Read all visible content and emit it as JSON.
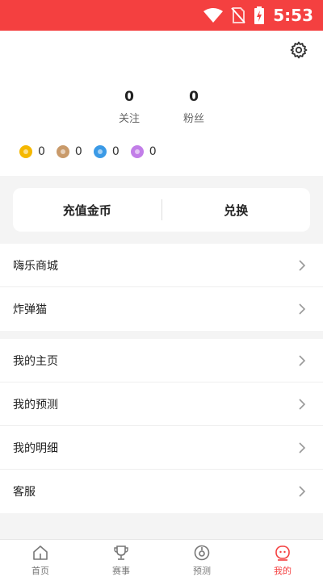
{
  "status_bar": {
    "time": "5:53"
  },
  "profile": {
    "following": {
      "value": "0",
      "label": "关注"
    },
    "fans": {
      "value": "0",
      "label": "粉丝"
    },
    "coins": [
      {
        "icon": "gold-coin-icon",
        "color": "#f5b800",
        "value": "0"
      },
      {
        "icon": "bronze-coin-icon",
        "color": "#c99a6a",
        "value": "0"
      },
      {
        "icon": "blue-gem-icon",
        "color": "#3b9ae6",
        "value": "0"
      },
      {
        "icon": "purple-gem-icon",
        "color": "#c27ee8",
        "value": "0"
      }
    ]
  },
  "actions": {
    "recharge": "充值金币",
    "exchange": "兑换"
  },
  "menu_group_1": [
    {
      "label": "嗨乐商城"
    },
    {
      "label": "炸弹猫"
    }
  ],
  "menu_group_2": [
    {
      "label": "我的主页"
    },
    {
      "label": "我的预测"
    },
    {
      "label": "我的明细"
    },
    {
      "label": "客服"
    }
  ],
  "tabs": [
    {
      "label": "首页",
      "icon": "home-icon"
    },
    {
      "label": "赛事",
      "icon": "trophy-icon"
    },
    {
      "label": "预测",
      "icon": "prediction-icon"
    },
    {
      "label": "我的",
      "icon": "profile-face-icon",
      "active": true
    }
  ],
  "colors": {
    "accent": "#f44040",
    "background": "#f4f4f4"
  }
}
